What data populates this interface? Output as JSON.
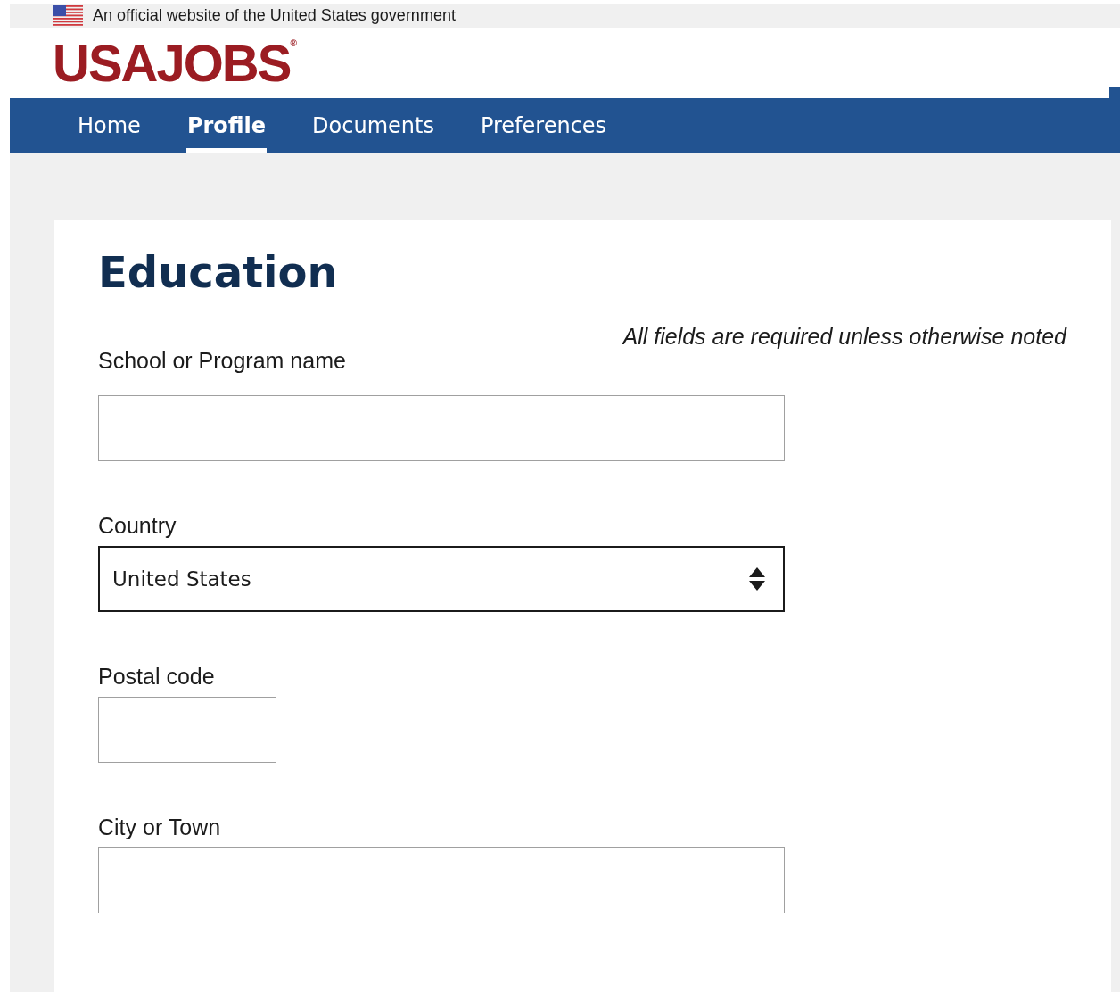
{
  "banner": {
    "text": "An official website of the United States government"
  },
  "logo": {
    "text": "USAJOBS",
    "mark": "®"
  },
  "nav": [
    {
      "label": "Home",
      "selected": false
    },
    {
      "label": "Profile",
      "selected": true
    },
    {
      "label": "Documents",
      "selected": false
    },
    {
      "label": "Preferences",
      "selected": false
    }
  ],
  "form": {
    "title": "Education",
    "note": "All fields are required unless otherwise noted",
    "fields": [
      {
        "kind": "text",
        "label": "School or Program name"
      },
      {
        "kind": "select",
        "label": "Country",
        "value": "United States"
      },
      {
        "kind": "short",
        "label": "Postal code"
      },
      {
        "kind": "text",
        "label": "City or Town"
      }
    ]
  }
}
